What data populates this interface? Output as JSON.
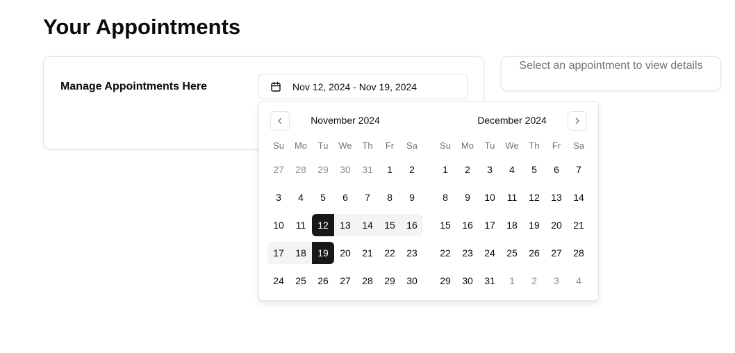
{
  "page": {
    "title": "Your Appointments"
  },
  "manage": {
    "title": "Manage Appointments Here",
    "date_range_label": "Nov 12, 2024 - Nov 19, 2024"
  },
  "details": {
    "placeholder": "Select an appointment to view details"
  },
  "calendar": {
    "weekdays": [
      "Su",
      "Mo",
      "Tu",
      "We",
      "Th",
      "Fr",
      "Sa"
    ],
    "accent_color": "#18181b",
    "range_color": "#f4f4f5",
    "months": [
      {
        "caption": "November 2024",
        "days": [
          {
            "d": "27",
            "s": "outside"
          },
          {
            "d": "28",
            "s": "outside"
          },
          {
            "d": "29",
            "s": "outside"
          },
          {
            "d": "30",
            "s": "outside"
          },
          {
            "d": "31",
            "s": "outside"
          },
          {
            "d": "1",
            "s": ""
          },
          {
            "d": "2",
            "s": ""
          },
          {
            "d": "3",
            "s": ""
          },
          {
            "d": "4",
            "s": ""
          },
          {
            "d": "5",
            "s": ""
          },
          {
            "d": "6",
            "s": ""
          },
          {
            "d": "7",
            "s": ""
          },
          {
            "d": "8",
            "s": ""
          },
          {
            "d": "9",
            "s": ""
          },
          {
            "d": "10",
            "s": ""
          },
          {
            "d": "11",
            "s": ""
          },
          {
            "d": "12",
            "s": "selected sel-start"
          },
          {
            "d": "13",
            "s": "in-range"
          },
          {
            "d": "14",
            "s": "in-range"
          },
          {
            "d": "15",
            "s": "in-range"
          },
          {
            "d": "16",
            "s": "in-range range-end-row"
          },
          {
            "d": "17",
            "s": "in-range range-start-row"
          },
          {
            "d": "18",
            "s": "in-range"
          },
          {
            "d": "19",
            "s": "selected sel-end"
          },
          {
            "d": "20",
            "s": ""
          },
          {
            "d": "21",
            "s": ""
          },
          {
            "d": "22",
            "s": ""
          },
          {
            "d": "23",
            "s": ""
          },
          {
            "d": "24",
            "s": ""
          },
          {
            "d": "25",
            "s": ""
          },
          {
            "d": "26",
            "s": ""
          },
          {
            "d": "27",
            "s": ""
          },
          {
            "d": "28",
            "s": ""
          },
          {
            "d": "29",
            "s": ""
          },
          {
            "d": "30",
            "s": ""
          }
        ]
      },
      {
        "caption": "December 2024",
        "days": [
          {
            "d": "1",
            "s": ""
          },
          {
            "d": "2",
            "s": ""
          },
          {
            "d": "3",
            "s": ""
          },
          {
            "d": "4",
            "s": ""
          },
          {
            "d": "5",
            "s": ""
          },
          {
            "d": "6",
            "s": ""
          },
          {
            "d": "7",
            "s": ""
          },
          {
            "d": "8",
            "s": ""
          },
          {
            "d": "9",
            "s": ""
          },
          {
            "d": "10",
            "s": ""
          },
          {
            "d": "11",
            "s": ""
          },
          {
            "d": "12",
            "s": ""
          },
          {
            "d": "13",
            "s": ""
          },
          {
            "d": "14",
            "s": ""
          },
          {
            "d": "15",
            "s": ""
          },
          {
            "d": "16",
            "s": ""
          },
          {
            "d": "17",
            "s": ""
          },
          {
            "d": "18",
            "s": ""
          },
          {
            "d": "19",
            "s": ""
          },
          {
            "d": "20",
            "s": ""
          },
          {
            "d": "21",
            "s": ""
          },
          {
            "d": "22",
            "s": ""
          },
          {
            "d": "23",
            "s": ""
          },
          {
            "d": "24",
            "s": ""
          },
          {
            "d": "25",
            "s": ""
          },
          {
            "d": "26",
            "s": ""
          },
          {
            "d": "27",
            "s": ""
          },
          {
            "d": "28",
            "s": ""
          },
          {
            "d": "29",
            "s": ""
          },
          {
            "d": "30",
            "s": ""
          },
          {
            "d": "31",
            "s": ""
          },
          {
            "d": "1",
            "s": "outside"
          },
          {
            "d": "2",
            "s": "outside"
          },
          {
            "d": "3",
            "s": "outside"
          },
          {
            "d": "4",
            "s": "outside"
          }
        ]
      }
    ]
  }
}
